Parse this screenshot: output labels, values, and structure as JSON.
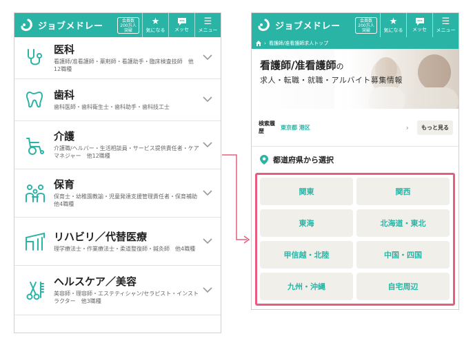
{
  "header": {
    "brand": "ジョブメドレー",
    "badge": [
      "会員数",
      "200万人",
      "突破"
    ],
    "buttons": [
      {
        "icon": "★",
        "label": "気になる"
      },
      {
        "icon": "💬",
        "label": "メッセ"
      },
      {
        "icon": "☰",
        "label": "メニュー"
      }
    ]
  },
  "categories": [
    {
      "title": "医科",
      "desc": "看護師/准看護師・薬剤師・看護助手・臨床検査技師　他12職種",
      "icon": "stethoscope-icon"
    },
    {
      "title": "歯科",
      "desc": "歯科医師・歯科衛生士・歯科助手・歯科技工士",
      "icon": "tooth-icon"
    },
    {
      "title": "介護",
      "desc": "介護職/ヘルパー・生活相談員・サービス提供責任者・ケアマネジャー　他12職種",
      "icon": "wheelchair-icon"
    },
    {
      "title": "保育",
      "desc": "保育士・幼稚園教諭・児童発達支援管理責任者・保育補助　他4職種",
      "icon": "children-icon"
    },
    {
      "title": "リハビリ／代替医療",
      "desc": "理学療法士・作業療法士・柔道整復師・鍼灸師　他4職種",
      "icon": "rehab-icon"
    },
    {
      "title": "ヘルスケア／美容",
      "desc": "美容師・理容師・エステティシャン/セラピスト・インストラクター　他3職種",
      "icon": "scissors-icon"
    }
  ],
  "breadcrumb": {
    "current": "看護師/准看護師求人トップ"
  },
  "hero": {
    "title": "看護師/准看護師",
    "title_suffix": "の",
    "subtitle": "求人・転職・就職・アルバイト募集情報"
  },
  "history": {
    "label": "検索履歴",
    "value": "東京都 港区",
    "more": "もっと見る"
  },
  "prefecture": {
    "heading": "都道府県から選択",
    "regions": [
      "関東",
      "関西",
      "東海",
      "北海道・東北",
      "甲信越・北陸",
      "中国・四国",
      "九州・沖縄",
      "自宅周辺"
    ]
  },
  "colors": {
    "brand": "#2ab4a6",
    "highlight": "#ea5c7e",
    "button_bg": "#f1efea"
  }
}
